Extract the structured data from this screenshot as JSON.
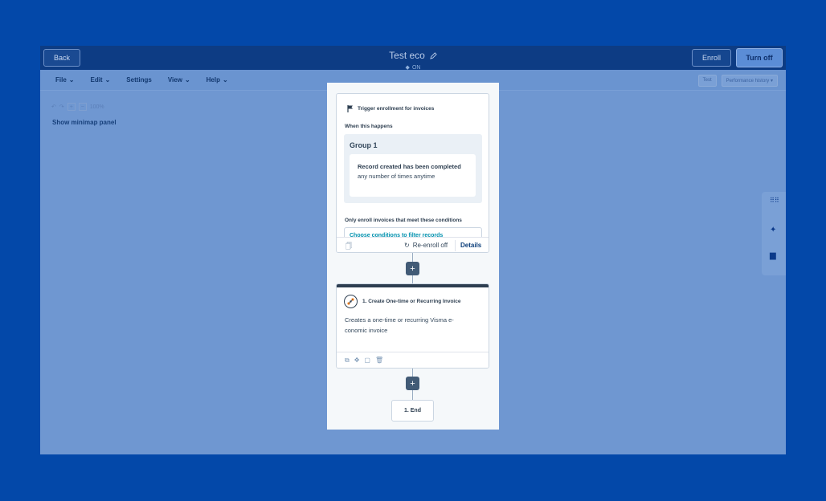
{
  "topbar": {
    "back_label": "Back",
    "workflow_title": "Test eco",
    "status": "ON",
    "enroll_label": "Enroll",
    "turn_off_label": "Turn off"
  },
  "menubar": {
    "file": "File",
    "edit": "Edit",
    "settings": "Settings",
    "view": "View",
    "help": "Help",
    "test": "Test",
    "performance_history": "Performance history"
  },
  "canvas_controls": {
    "zoom_level": "100%",
    "show_minimap": "Show minimap panel"
  },
  "trigger": {
    "title": "Trigger enrollment for invoices",
    "when_label": "When this happens",
    "group_title": "Group 1",
    "rule_bold": "Record created has been completed",
    "rule_rest": "any number of times anytime",
    "only_enroll_label": "Only enroll invoices that meet these conditions",
    "choose_conditions": "Choose conditions to filter records",
    "reenroll": "Re-enroll off",
    "details": "Details"
  },
  "action": {
    "title": "1. Create One-time or Recurring Invoice",
    "description": "Creates a one-time or recurring Visma e-conomic invoice"
  },
  "end": {
    "label": "1. End"
  },
  "colors": {
    "overlay_blue": "#0348a9",
    "primary_dark": "#2d3e50",
    "link": "#0091ae"
  }
}
